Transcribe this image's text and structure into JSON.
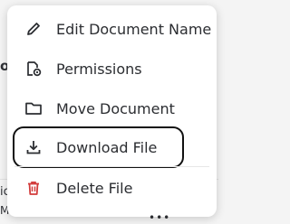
{
  "background": {
    "fragment_top": "o",
    "fragment_bottom_left": "ic",
    "fragment_bottom_left2": "M"
  },
  "menu": {
    "items": [
      {
        "label": "Edit Document Name",
        "icon": "pencil-icon"
      },
      {
        "label": "Permissions",
        "icon": "permissions-gear-icon"
      },
      {
        "label": "Move Document",
        "icon": "folder-icon"
      },
      {
        "label": "Download File",
        "icon": "download-icon",
        "selected": true
      },
      {
        "label": "Delete File",
        "icon": "trash-icon",
        "color": "#d23b3b"
      }
    ]
  },
  "colors": {
    "danger": "#d23b3b",
    "text": "#2b2d31",
    "selection_border": "#111111"
  }
}
